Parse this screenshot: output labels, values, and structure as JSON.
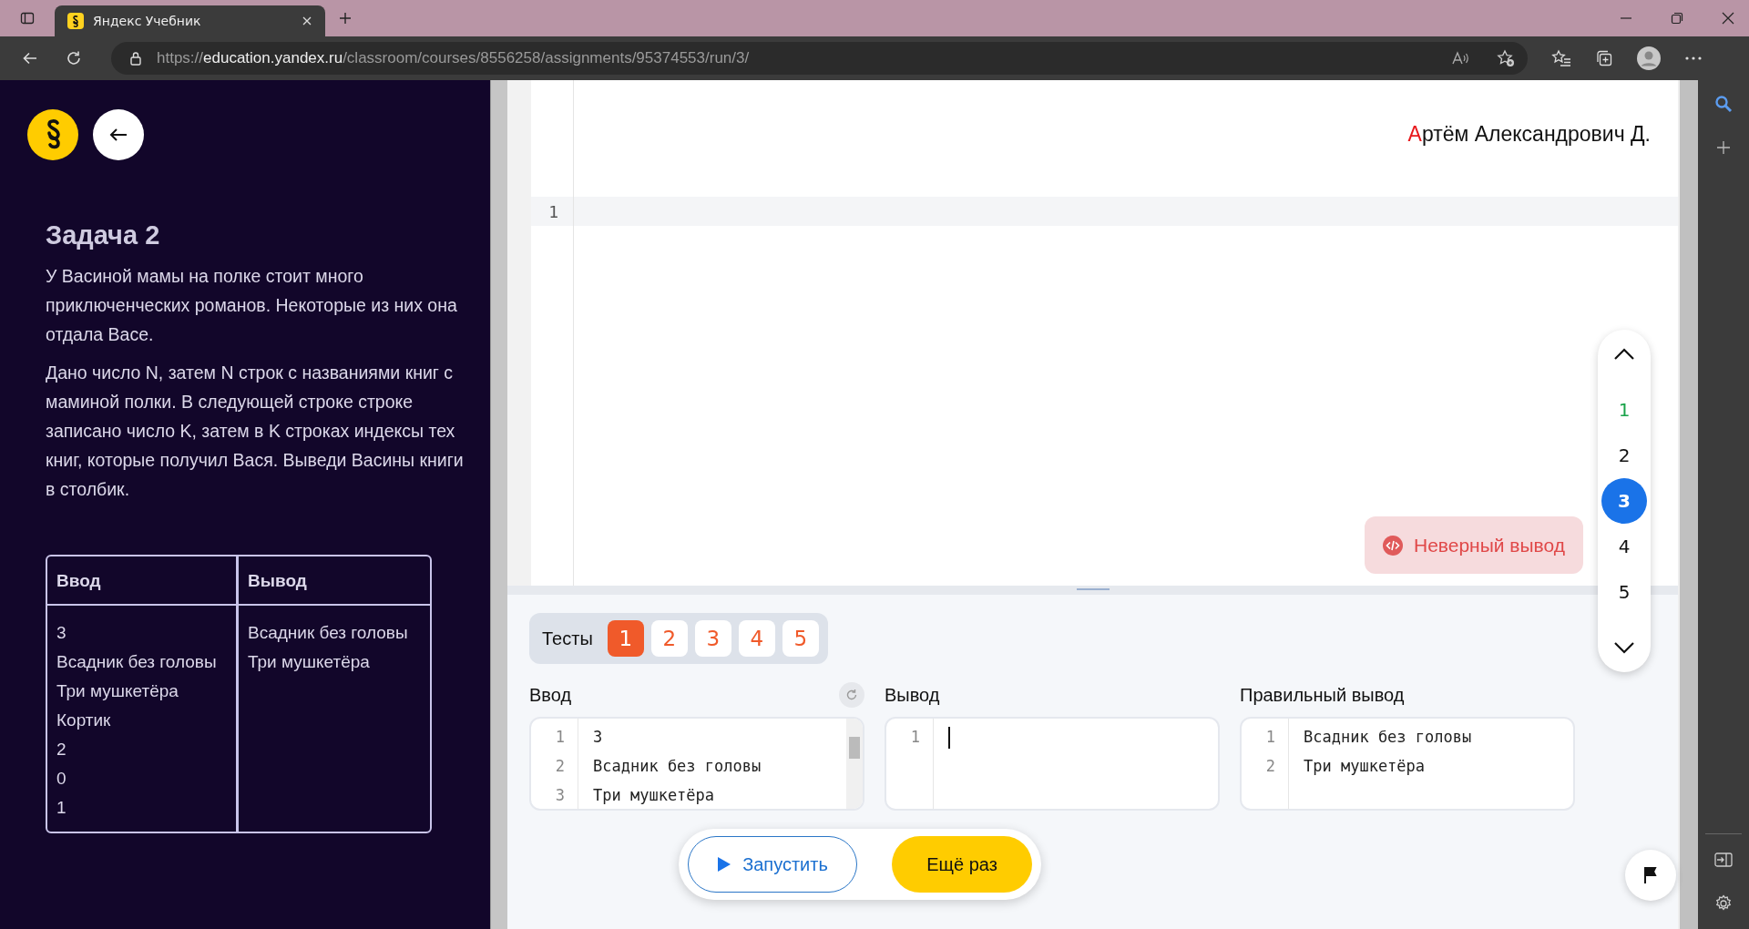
{
  "browser": {
    "tab_title": "Яндекс Учебник",
    "url_scheme": "https://",
    "url_host": "education.yandex.ru",
    "url_path": "/classroom/courses/8556258/assignments/95374553/run/3/"
  },
  "task": {
    "title": "Задача 2",
    "paragraphs": [
      "У Васиной мамы на полке стоит много приключенческих романов. Некоторые из них она отдала Васе.",
      "Дано число N, затем N строк с названиями книг с маминой полки. В следующей строке строке записано число K, затем в K строках индексы тех книг, которые получил Вася. Выведи Васины книги в столбик."
    ],
    "example": {
      "columns": [
        "Ввод",
        "Вывод"
      ],
      "input": [
        "3",
        "Всадник без головы",
        "Три мушкетёра",
        "Кортик",
        "2",
        "0",
        "1"
      ],
      "output": [
        "Всадник без головы",
        "Три мушкетёра"
      ]
    }
  },
  "editor": {
    "user_initial": "А",
    "user_rest": "ртём Александрович Д.",
    "line_numbers": [
      "1"
    ],
    "verdict": "Неверный вывод"
  },
  "attempts": [
    {
      "label": "1",
      "passed": true,
      "selected": false
    },
    {
      "label": "2",
      "passed": false,
      "selected": false
    },
    {
      "label": "3",
      "passed": false,
      "selected": true
    },
    {
      "label": "4",
      "passed": false,
      "selected": false
    },
    {
      "label": "5",
      "passed": false,
      "selected": false
    }
  ],
  "tests": {
    "label": "Тесты",
    "items": [
      {
        "label": "1",
        "selected": true
      },
      {
        "label": "2",
        "selected": false
      },
      {
        "label": "3",
        "selected": false
      },
      {
        "label": "4",
        "selected": false
      },
      {
        "label": "5",
        "selected": false
      }
    ]
  },
  "panes": [
    {
      "title": "Ввод",
      "kind": "input",
      "line_numbers": [
        "1",
        "2",
        "3"
      ],
      "lines": [
        "3",
        "Всадник без головы",
        "Три мушкетёра"
      ]
    },
    {
      "title": "Вывод",
      "kind": "output",
      "line_numbers": [
        "1"
      ],
      "cursor": true
    },
    {
      "title": "Правильный вывод",
      "kind": "expected",
      "line_numbers": [
        "1",
        "2"
      ],
      "lines": [
        "Всадник без головы",
        "Три мушкетёра"
      ]
    }
  ],
  "buttons": {
    "run": "Запустить",
    "retry": "Ещё раз"
  }
}
